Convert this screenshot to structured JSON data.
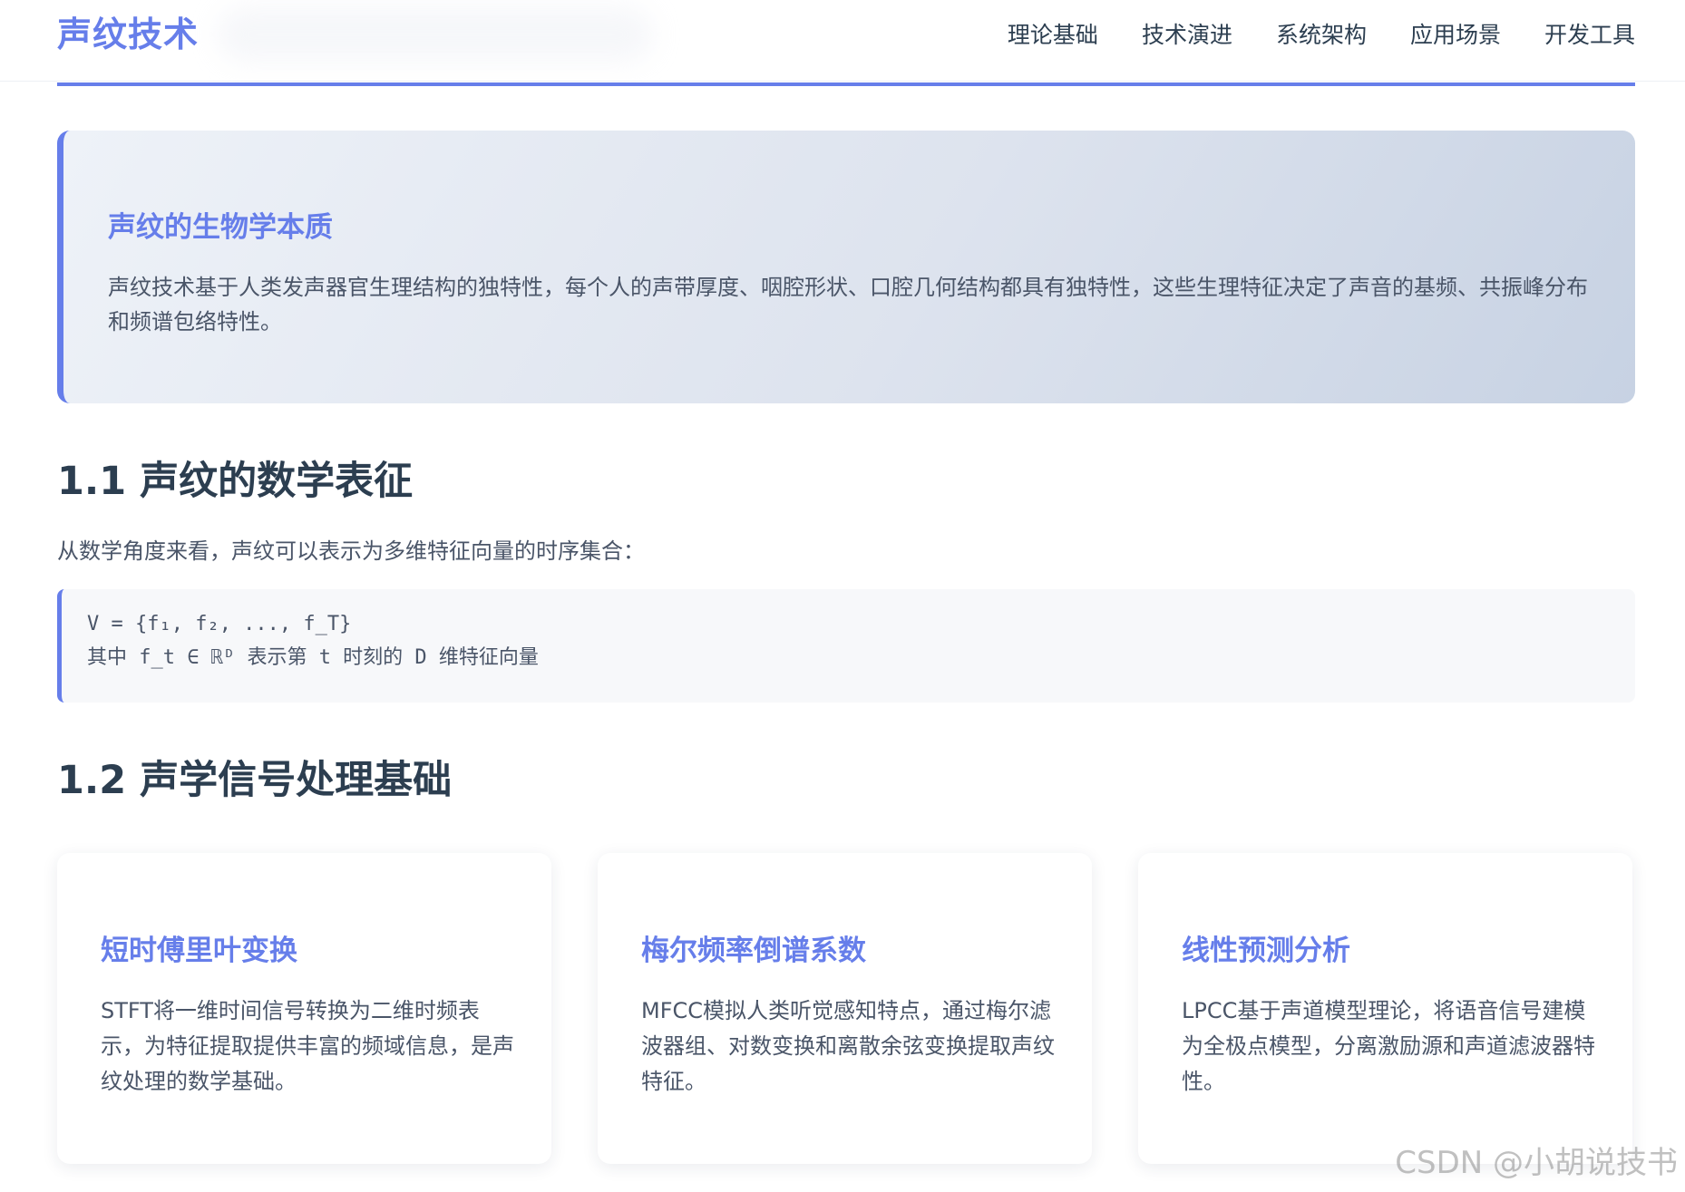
{
  "header": {
    "brand": "声纹技术",
    "nav": [
      "理论基础",
      "技术演进",
      "系统架构",
      "应用场景",
      "开发工具"
    ]
  },
  "highlight": {
    "title": "声纹的生物学本质",
    "text": "声纹技术基于人类发声器官生理结构的独特性，每个人的声带厚度、咽腔形状、口腔几何结构都具有独特性，这些生理特征决定了声音的基频、共振峰分布和频谱包络特性。"
  },
  "section1": {
    "title": "1.1 声纹的数学表征",
    "intro": "从数学角度来看，声纹可以表示为多维特征向量的时序集合：",
    "code": [
      "V = {f₁, f₂, ..., f_T}",
      "其中 f_t ∈ ℝᴰ 表示第 t 时刻的 D 维特征向量"
    ]
  },
  "section2": {
    "title": "1.2 声学信号处理基础",
    "cards": [
      {
        "title": "短时傅里叶变换",
        "text": "STFT将一维时间信号转换为二维时频表示，为特征提取提供丰富的频域信息，是声纹处理的数学基础。"
      },
      {
        "title": "梅尔频率倒谱系数",
        "text": "MFCC模拟人类听觉感知特点，通过梅尔滤波器组、对数变换和离散余弦变换提取声纹特征。"
      },
      {
        "title": "线性预测分析",
        "text": "LPCC基于声道模型理论，将语音信号建模为全极点模型，分离激励源和声道滤波器特性。"
      }
    ]
  },
  "watermark": "CSDN @小胡说技书",
  "colors": {
    "accent": "#667eea",
    "heading": "#2c3e50",
    "body_text": "#4a5568"
  }
}
